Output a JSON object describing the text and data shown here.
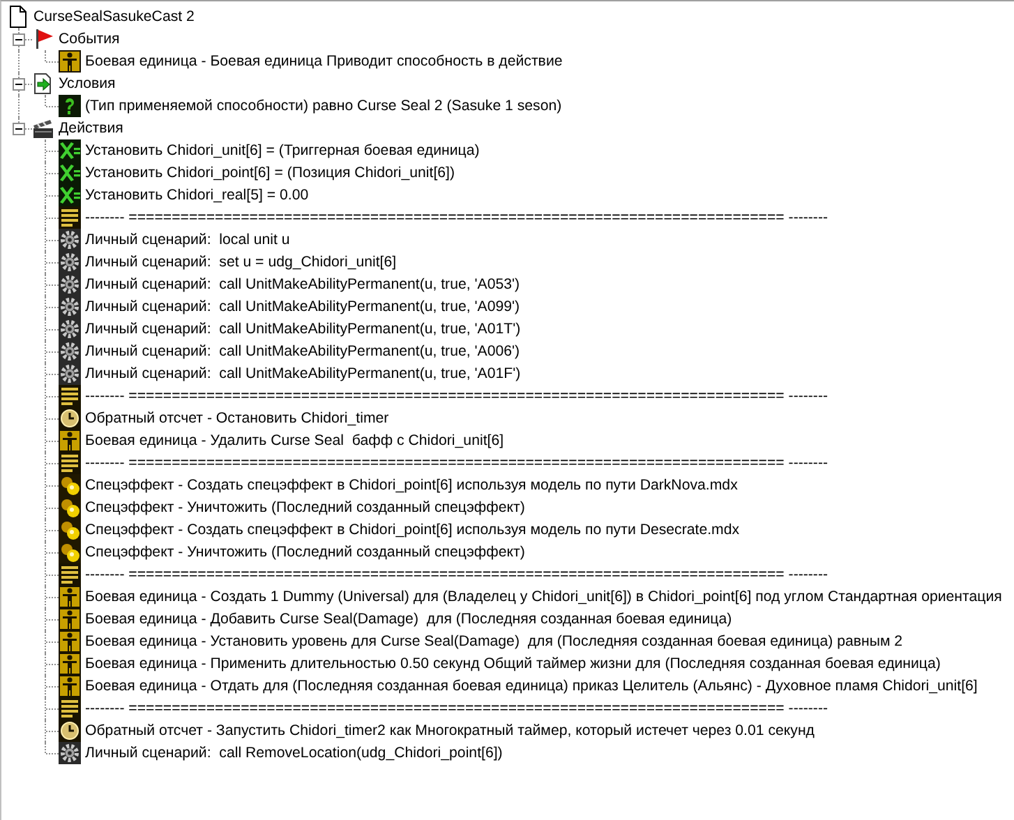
{
  "trigger": {
    "title": "CurseSealSasukeCast 2",
    "sections": [
      {
        "kind": "events",
        "label": "События",
        "expanded": true,
        "items": [
          {
            "kind": "unit",
            "text": "Боевая единица - Боевая единица Приводит способность в действие"
          }
        ]
      },
      {
        "kind": "conditions",
        "label": "Условия",
        "expanded": true,
        "items": [
          {
            "kind": "condition",
            "text": "(Тип применяемой способности) равно Curse Seal 2 (Sasuke 1 seson)"
          }
        ]
      },
      {
        "kind": "actions",
        "label": "Действия",
        "expanded": true,
        "items": [
          {
            "kind": "set",
            "text": "Установить Chidori_unit[6] = (Триггерная боевая единица)"
          },
          {
            "kind": "set",
            "text": "Установить Chidori_point[6] = (Позиция Chidori_unit[6])"
          },
          {
            "kind": "set",
            "text": "Установить Chidori_real[5] = 0.00"
          },
          {
            "kind": "comment",
            "text": "-------- ============================================================================ --------"
          },
          {
            "kind": "script",
            "text": "Личный сценарий:  local unit u"
          },
          {
            "kind": "script",
            "text": "Личный сценарий:  set u = udg_Chidori_unit[6]"
          },
          {
            "kind": "script",
            "text": "Личный сценарий:  call UnitMakeAbilityPermanent(u, true, 'A053')"
          },
          {
            "kind": "script",
            "text": "Личный сценарий:  call UnitMakeAbilityPermanent(u, true, 'A099')"
          },
          {
            "kind": "script",
            "text": "Личный сценарий:  call UnitMakeAbilityPermanent(u, true, 'A01T')"
          },
          {
            "kind": "script",
            "text": "Личный сценарий:  call UnitMakeAbilityPermanent(u, true, 'A006')"
          },
          {
            "kind": "script",
            "text": "Личный сценарий:  call UnitMakeAbilityPermanent(u, true, 'A01F')"
          },
          {
            "kind": "comment",
            "text": "-------- ============================================================================ --------"
          },
          {
            "kind": "timer",
            "text": "Обратный отсчет - Остановить Chidori_timer"
          },
          {
            "kind": "unit",
            "text": "Боевая единица - Удалить Curse Seal  бафф с Chidori_unit[6]"
          },
          {
            "kind": "comment",
            "text": "-------- ============================================================================ --------"
          },
          {
            "kind": "effect",
            "text": "Спецэффект - Создать спецэффект в Chidori_point[6] используя модель по пути DarkNova.mdx"
          },
          {
            "kind": "effect",
            "text": "Спецэффект - Уничтожить (Последний созданный спецэффект)"
          },
          {
            "kind": "effect",
            "text": "Спецэффект - Создать спецэффект в Chidori_point[6] используя модель по пути Desecrate.mdx"
          },
          {
            "kind": "effect",
            "text": "Спецэффект - Уничтожить (Последний созданный спецэффект)"
          },
          {
            "kind": "comment",
            "text": "-------- ============================================================================ --------"
          },
          {
            "kind": "unit",
            "text": "Боевая единица - Создать 1 Dummy (Universal) для (Владелец у Chidori_unit[6]) в Chidori_point[6] под углом Стандартная ориентация"
          },
          {
            "kind": "unit",
            "text": "Боевая единица - Добавить Curse Seal(Damage)  для (Последняя созданная боевая единица)"
          },
          {
            "kind": "unit",
            "text": "Боевая единица - Установить уровень для Curse Seal(Damage)  для (Последняя созданная боевая единица) равным 2"
          },
          {
            "kind": "unit",
            "text": "Боевая единица - Применить длительностью 0.50 секунд Общий таймер жизни для (Последняя созданная боевая единица)"
          },
          {
            "kind": "unit",
            "text": "Боевая единица - Отдать для (Последняя созданная боевая единица) приказ Целитель (Альянс) - Духовное пламя Chidori_unit[6]"
          },
          {
            "kind": "comment",
            "text": "-------- ============================================================================ --------"
          },
          {
            "kind": "timer",
            "text": "Обратный отсчет - Запустить Chidori_timer2 как Многократный таймер, который истечет через 0.01 секунд"
          },
          {
            "kind": "script",
            "text": "Личный сценарий:  call RemoveLocation(udg_Chidori_point[6])"
          }
        ]
      }
    ]
  }
}
